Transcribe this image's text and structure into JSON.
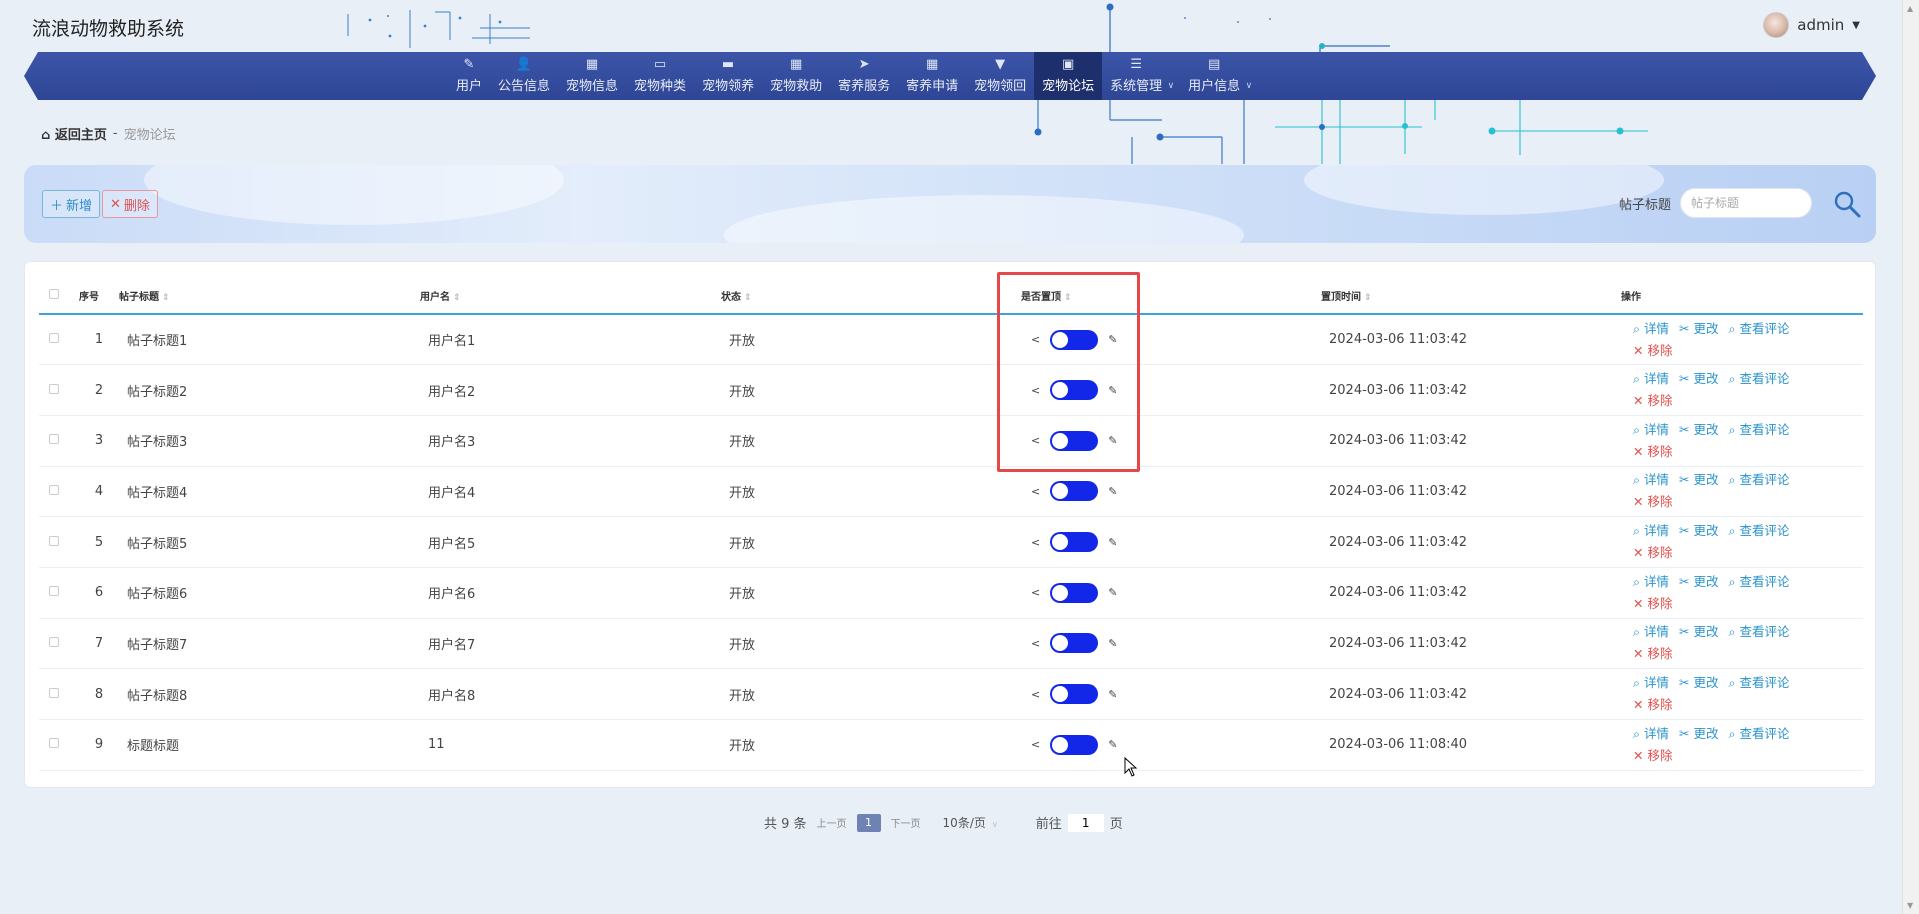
{
  "app": {
    "title": "流浪动物救助系统"
  },
  "user": {
    "name": "admin"
  },
  "nav": [
    {
      "label": "用户",
      "icon": "user-edit-icon",
      "glyph": "✎",
      "active": false,
      "has_sub": false
    },
    {
      "label": "公告信息",
      "icon": "person-icon",
      "glyph": "👤",
      "active": false,
      "has_sub": false
    },
    {
      "label": "宠物信息",
      "icon": "grid-icon",
      "glyph": "▦",
      "active": false,
      "has_sub": false
    },
    {
      "label": "宠物种类",
      "icon": "briefcase-icon",
      "glyph": "▭",
      "active": false,
      "has_sub": false
    },
    {
      "label": "宠物领养",
      "icon": "monitor-icon",
      "glyph": "▬",
      "active": false,
      "has_sub": false
    },
    {
      "label": "宠物救助",
      "icon": "grid-icon",
      "glyph": "▦",
      "active": false,
      "has_sub": false
    },
    {
      "label": "寄养服务",
      "icon": "send-icon",
      "glyph": "➤",
      "active": false,
      "has_sub": false
    },
    {
      "label": "寄养申请",
      "icon": "grid-icon",
      "glyph": "▦",
      "active": false,
      "has_sub": false
    },
    {
      "label": "宠物领回",
      "icon": "pin-icon",
      "glyph": "▼",
      "active": false,
      "has_sub": false
    },
    {
      "label": "宠物论坛",
      "icon": "clipboard-icon",
      "glyph": "▣",
      "active": true,
      "has_sub": false
    },
    {
      "label": "系统管理",
      "icon": "menu-icon",
      "glyph": "☰",
      "active": false,
      "has_sub": true
    },
    {
      "label": "用户信息",
      "icon": "card-icon",
      "glyph": "▤",
      "active": false,
      "has_sub": true
    }
  ],
  "breadcrumb": {
    "home": "返回主页",
    "separator": "-",
    "current": "宠物论坛"
  },
  "toolbar": {
    "add_label": "新增",
    "delete_label": "删除",
    "search_label": "帖子标题",
    "search_placeholder": "帖子标题",
    "search_value": ""
  },
  "table": {
    "columns": [
      "序号",
      "帖子标题",
      "用户名",
      "状态",
      "是否置顶",
      "置顶时间",
      "操作"
    ],
    "actions": {
      "detail": "详情",
      "edit": "更改",
      "comments": "查看评论",
      "remove": "移除"
    },
    "rows": [
      {
        "no": "1",
        "title": "帖子标题1",
        "user": "用户名1",
        "status": "开放",
        "pinned": true,
        "time": "2024-03-06 11:03:42"
      },
      {
        "no": "2",
        "title": "帖子标题2",
        "user": "用户名2",
        "status": "开放",
        "pinned": true,
        "time": "2024-03-06 11:03:42"
      },
      {
        "no": "3",
        "title": "帖子标题3",
        "user": "用户名3",
        "status": "开放",
        "pinned": true,
        "time": "2024-03-06 11:03:42"
      },
      {
        "no": "4",
        "title": "帖子标题4",
        "user": "用户名4",
        "status": "开放",
        "pinned": true,
        "time": "2024-03-06 11:03:42"
      },
      {
        "no": "5",
        "title": "帖子标题5",
        "user": "用户名5",
        "status": "开放",
        "pinned": true,
        "time": "2024-03-06 11:03:42"
      },
      {
        "no": "6",
        "title": "帖子标题6",
        "user": "用户名6",
        "status": "开放",
        "pinned": true,
        "time": "2024-03-06 11:03:42"
      },
      {
        "no": "7",
        "title": "帖子标题7",
        "user": "用户名7",
        "status": "开放",
        "pinned": true,
        "time": "2024-03-06 11:03:42"
      },
      {
        "no": "8",
        "title": "帖子标题8",
        "user": "用户名8",
        "status": "开放",
        "pinned": true,
        "time": "2024-03-06 11:03:42"
      },
      {
        "no": "9",
        "title": "标题标题",
        "user": "11",
        "status": "开放",
        "pinned": true,
        "time": "2024-03-06 11:08:40"
      }
    ]
  },
  "pagination": {
    "total": "共 9 条",
    "prev": "上一页",
    "current": "1",
    "next": "下一页",
    "page_size": "10条/页",
    "goto_prefix": "前往",
    "goto_value": "1",
    "goto_suffix": "页"
  },
  "colors": {
    "nav_bg": "#3c55a8",
    "nav_active": "#1e2f6e",
    "switch_on": "#1227e8",
    "highlight": "#e5474a",
    "link_blue": "#2a93cc",
    "link_red": "#e0504c"
  }
}
